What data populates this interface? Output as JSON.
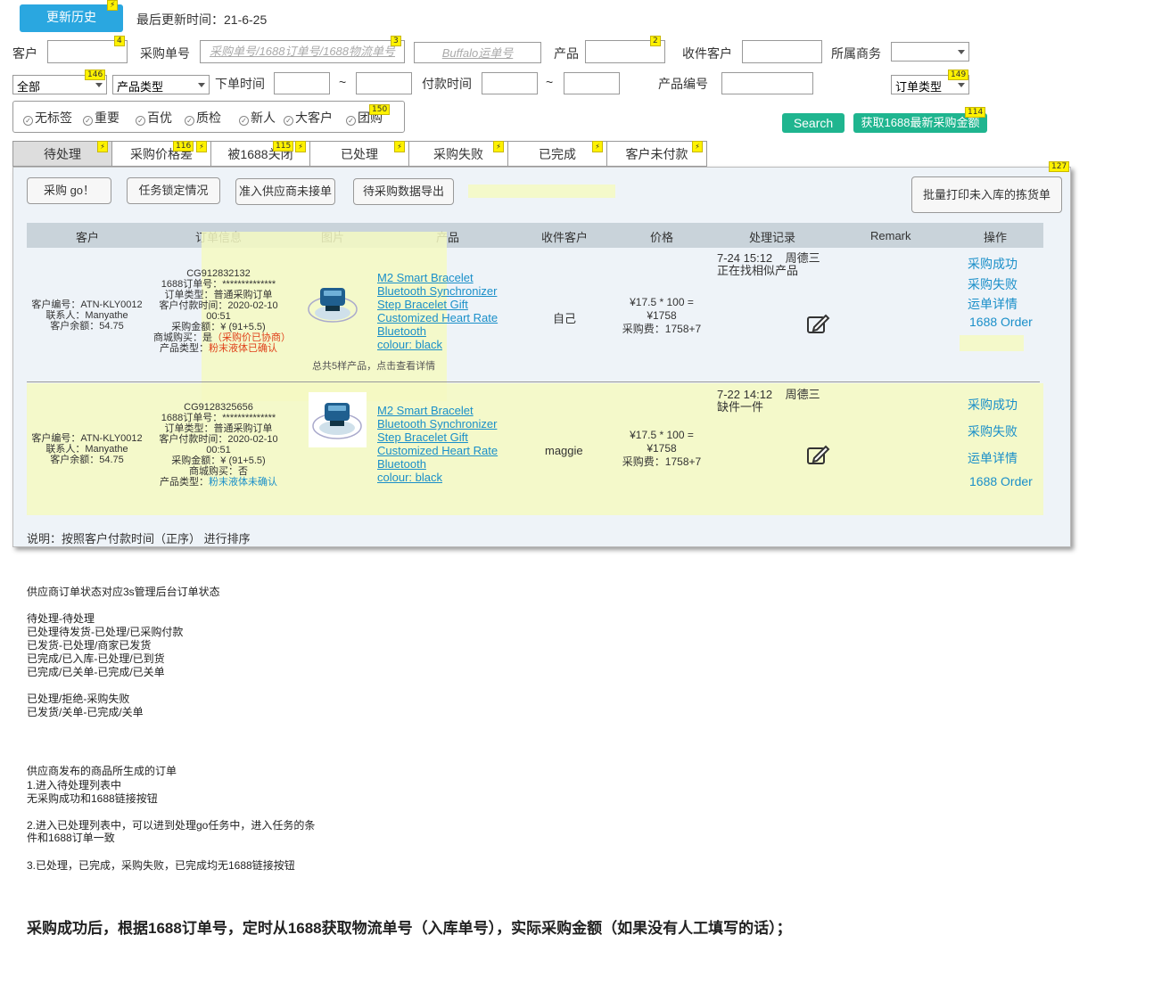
{
  "header": {
    "history_button": "更新历史",
    "last_update_label": "最后更新时间：21-6-25"
  },
  "badges": {
    "history": "⚡",
    "customer": "4",
    "purchase_no": "3",
    "product": "2",
    "all_select": "146",
    "order_type": "149",
    "group": "150",
    "fetch": "114",
    "tab_price": "116",
    "tab_closed": "115",
    "batch_print": "127"
  },
  "filters": {
    "customer_label": "客户",
    "purchase_no_label": "采购单号",
    "purchase_no_placeholder": "采购单号/1688订单号/1688物流单号",
    "buffalo_placeholder": "Buffalo运单号",
    "product_label": "产品",
    "receiver_label": "收件客户",
    "business_label": "所属商务",
    "all_select": "全部",
    "product_type_select": "产品类型",
    "order_time_label": "下单时间",
    "tilde": "~",
    "pay_time_label": "付款时间",
    "product_code_label": "产品编号",
    "order_type_select": "订单类型",
    "tags": [
      "无标签",
      "重要",
      "百优",
      "质检",
      "新人",
      "大客户",
      "团购"
    ],
    "search_button": "Search",
    "fetch_button": "获取1688最新采购金额"
  },
  "tabs": [
    "待处理",
    "采购价格差",
    "被1688关闭",
    "已处理",
    "采购失败",
    "已完成",
    "客户未付款"
  ],
  "toolbar": {
    "go": "采购 go！",
    "lock": "任务锁定情况",
    "unaccepted": "准入供应商未接单",
    "export": "待采购数据导出",
    "batch_print": "批量打印未入库的拣货单"
  },
  "table": {
    "headers": [
      "客户",
      "订单信息",
      "图片",
      "产品",
      "收件客户",
      "价格",
      "处理记录",
      "Remark",
      "操作"
    ],
    "rows": [
      {
        "customer": [
          "客户编号：ATN-KLY0012",
          "联系人：Manyathe",
          "客户余额：54.75"
        ],
        "order": [
          "CG912832132",
          "1688订单号：**************",
          "订单类型：普通采购订单",
          "客户付款时间：2020-02-10",
          "00:51",
          "采购金额：¥ (91+5.5)"
        ],
        "mall_label": "商城购买：",
        "mall_value": "是",
        "mall_extra": "（采购价已协商）",
        "ptype_label": "产品类型：",
        "ptype_value": "粉末液体已确认",
        "product": [
          "M2 Smart Bracelet",
          "Bluetooth Synchronizer",
          "Step Bracelet Gift",
          "Customized Heart Rate",
          "Bluetooth"
        ],
        "colour": "colour: black",
        "summary": "总共5样产品，点击查看详情",
        "receiver": "自己",
        "price": [
          "¥17.5 * 100 =",
          "¥1758",
          "采购费：1758+7"
        ],
        "log_time": "7-24 15:12",
        "log_user": "周德三",
        "log_text": "正在找相似产品",
        "ops": [
          "采购成功",
          "采购失败",
          "运单详情",
          "1688 Order"
        ]
      },
      {
        "customer": [
          "客户编号：ATN-KLY0012",
          "联系人：Manyathe",
          "客户余额：54.75"
        ],
        "order": [
          "CG9128325656",
          "1688订单号：**************",
          "订单类型：普通采购订单",
          "客户付款时间：2020-02-10",
          "00:51",
          "采购金额：¥ (91+5.5)"
        ],
        "mall_label": "商城购买：",
        "mall_value": "否",
        "mall_extra": "",
        "ptype_label": "产品类型：",
        "ptype_value": "粉末液体未确认",
        "product": [
          "M2 Smart Bracelet",
          "Bluetooth Synchronizer",
          "Step Bracelet Gift",
          "Customized Heart Rate",
          "Bluetooth"
        ],
        "colour": "colour: black",
        "summary": "",
        "receiver": "maggie",
        "price": [
          "¥17.5 * 100 =",
          "¥1758",
          "采购费：1758+7"
        ],
        "log_time": "7-22 14:12",
        "log_user": "周德三",
        "log_text": "缺件一件",
        "ops": [
          "采购成功",
          "采购失败",
          "运单详情",
          "1688 Order"
        ]
      }
    ],
    "sort_note": "说明：按照客户付款时间（正序） 进行排序"
  },
  "notes": {
    "block1": [
      "供应商订单状态对应3s管理后台订单状态",
      "",
      "待处理-待处理",
      "已处理待发货-已处理/已采购付款",
      "已发货-已处理/商家已发货",
      "已完成/已入库-已处理/已到货",
      "已完成/已关单-已完成/已关单",
      "",
      "已处理/拒绝-采购失败",
      "已发货/关单-已完成/关单"
    ],
    "block2": [
      "供应商发布的商品所生成的订单",
      "1.进入待处理列表中",
      "无采购成功和1688链接按钮",
      "",
      "2.进入已处理列表中，可以进到处理go任务中，进入任务的条",
      "件和1688订单一致",
      "",
      "3.已处理，已完成，采购失败，已完成均无1688链接按钮"
    ],
    "bold": "采购成功后，根据1688订单号，定时从1688获取物流单号（入库单号），实际采购金额（如果没有人工填写的话）；"
  },
  "colors": {
    "primary": "#2aa7e0",
    "green": "#1fb58f",
    "link": "#1a8fc9",
    "highlight": "#f4f9c2",
    "badge": "#fff200",
    "danger": "#e0401a"
  }
}
